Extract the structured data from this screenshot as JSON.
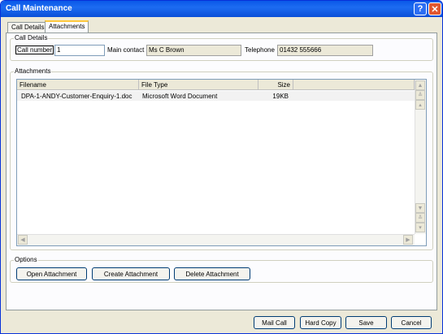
{
  "window": {
    "title": "Call Maintenance"
  },
  "tabs": [
    {
      "label": "Call Details"
    },
    {
      "label": "Attachments"
    }
  ],
  "call_details": {
    "group_title": "Call Details",
    "call_number_label": "Call number",
    "call_number_value": "1",
    "main_contact_label": "Main contact",
    "main_contact_value": "Ms C Brown",
    "telephone_label": "Telephone",
    "telephone_value": "01432 555666"
  },
  "attachments": {
    "group_title": "Attachments",
    "columns": [
      "Filename",
      "File Type",
      "Size"
    ],
    "rows": [
      {
        "filename": "DPA-1-ANDY-Customer-Enquiry-1.doc",
        "file_type": "Microsoft Word Document",
        "size": "19KB"
      }
    ]
  },
  "options": {
    "group_title": "Options",
    "open_label": "Open Attachment",
    "create_label": "Create Attachment",
    "delete_label": "Delete Attachment"
  },
  "footer": {
    "mail_call": "Mail Call",
    "hard_copy": "Hard Copy",
    "save": "Save",
    "cancel": "Cancel"
  },
  "icons": {
    "help": "help-icon",
    "close": "close-icon",
    "scroll_up": "arrow-up-icon",
    "scroll_down": "arrow-down-icon",
    "scroll_left": "arrow-left-icon",
    "scroll_right": "arrow-right-icon"
  }
}
